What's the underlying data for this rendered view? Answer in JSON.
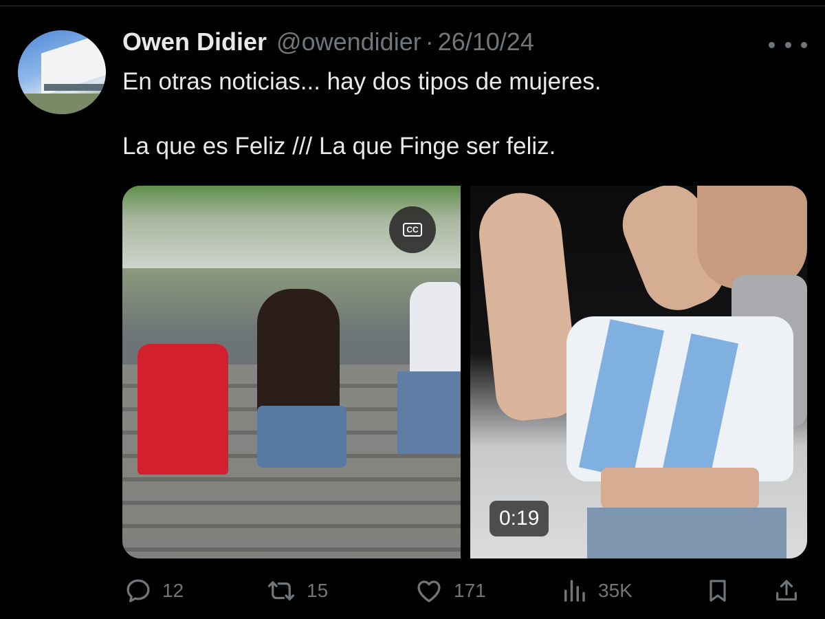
{
  "tweet": {
    "author_name": "Owen Didier",
    "author_handle": "@owendidier",
    "separator": "·",
    "date": "26/10/24",
    "text_line1": "En otras noticias... hay dos tipos de mujeres.",
    "text_line2": "La que es Feliz /// La que Finge ser feliz."
  },
  "media": {
    "captions_label": "CC",
    "duration": "0:19"
  },
  "actions": {
    "replies": "12",
    "reposts": "15",
    "likes": "171",
    "views": "35K"
  },
  "icons": {
    "more": "more-horizontal-icon",
    "reply": "reply-icon",
    "repost": "repost-icon",
    "like": "heart-icon",
    "views": "views-icon",
    "bookmark": "bookmark-icon",
    "share": "share-icon",
    "captions": "closed-captions-icon"
  },
  "colors": {
    "background": "#000000",
    "primary_text": "#e7e9ea",
    "secondary_text": "#71767b"
  }
}
